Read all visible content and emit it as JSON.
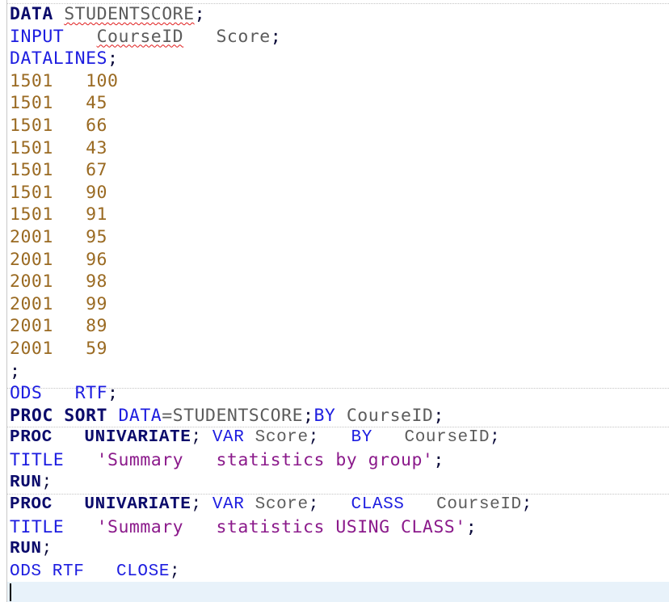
{
  "editor": {
    "lines": [
      {
        "tokens": [
          {
            "t": "DATA",
            "k": "kw-bold"
          },
          {
            "t": " ",
            "k": "space"
          },
          {
            "t": "STUDENTSCORE",
            "k": "ident",
            "sq": true
          },
          {
            "t": ";",
            "k": "punct"
          }
        ]
      },
      {
        "tokens": [
          {
            "t": "INPUT",
            "k": "kw"
          },
          {
            "t": "   ",
            "k": "space"
          },
          {
            "t": "CourseID",
            "k": "ident",
            "sq": true
          },
          {
            "t": "   ",
            "k": "space"
          },
          {
            "t": "Score",
            "k": "ident"
          },
          {
            "t": ";",
            "k": "punct"
          }
        ]
      },
      {
        "tokens": [
          {
            "t": "DATALINES",
            "k": "kw"
          },
          {
            "t": ";",
            "k": "punct"
          }
        ]
      },
      {
        "tokens": [
          {
            "t": "1501   100",
            "k": "data"
          }
        ]
      },
      {
        "tokens": [
          {
            "t": "1501   45",
            "k": "data"
          }
        ]
      },
      {
        "tokens": [
          {
            "t": "1501   66",
            "k": "data"
          }
        ]
      },
      {
        "tokens": [
          {
            "t": "1501   43",
            "k": "data"
          }
        ]
      },
      {
        "tokens": [
          {
            "t": "1501   67",
            "k": "data"
          }
        ]
      },
      {
        "tokens": [
          {
            "t": "1501   90",
            "k": "data"
          }
        ]
      },
      {
        "tokens": [
          {
            "t": "1501   91",
            "k": "data"
          }
        ]
      },
      {
        "tokens": [
          {
            "t": "2001   95",
            "k": "data"
          }
        ]
      },
      {
        "tokens": [
          {
            "t": "2001   96",
            "k": "data"
          }
        ]
      },
      {
        "tokens": [
          {
            "t": "2001   98",
            "k": "data"
          }
        ]
      },
      {
        "tokens": [
          {
            "t": "2001   99",
            "k": "data"
          }
        ]
      },
      {
        "tokens": [
          {
            "t": "2001   89",
            "k": "data"
          }
        ]
      },
      {
        "tokens": [
          {
            "t": "2001   59",
            "k": "data"
          }
        ]
      },
      {
        "tokens": [
          {
            "t": ";",
            "k": "punct"
          }
        ]
      },
      {
        "tokens": [
          {
            "t": "ODS",
            "k": "kw"
          },
          {
            "t": "   ",
            "k": "space"
          },
          {
            "t": "RTF",
            "k": "kw"
          },
          {
            "t": ";",
            "k": "punct"
          }
        ]
      },
      {
        "tokens": [
          {
            "t": "PROC SORT",
            "k": "kw-bold"
          },
          {
            "t": " ",
            "k": "space"
          },
          {
            "t": "DATA",
            "k": "kw"
          },
          {
            "t": "=STUDENTSCORE",
            "k": "ident"
          },
          {
            "t": ";",
            "k": "punct"
          },
          {
            "t": "BY",
            "k": "kw"
          },
          {
            "t": " ",
            "k": "space"
          },
          {
            "t": "CourseID",
            "k": "ident"
          },
          {
            "t": ";",
            "k": "punct"
          }
        ]
      },
      {
        "narrow": true,
        "tokens": [
          {
            "t": "PROC",
            "k": "kw-bold"
          },
          {
            "t": "   ",
            "k": "space"
          },
          {
            "t": "UNIVARIATE",
            "k": "kw-bold"
          },
          {
            "t": ";",
            "k": "punct"
          },
          {
            "t": " ",
            "k": "space"
          },
          {
            "t": "VAR",
            "k": "kw"
          },
          {
            "t": " ",
            "k": "space"
          },
          {
            "t": "Score",
            "k": "ident"
          },
          {
            "t": ";",
            "k": "punct"
          },
          {
            "t": "   ",
            "k": "space"
          },
          {
            "t": "BY",
            "k": "kw"
          },
          {
            "t": "   ",
            "k": "space"
          },
          {
            "t": "CourseID",
            "k": "ident"
          },
          {
            "t": ";",
            "k": "punct"
          }
        ]
      },
      {
        "tokens": [
          {
            "t": "TITLE",
            "k": "kw"
          },
          {
            "t": "   ",
            "k": "space"
          },
          {
            "t": "'Summary   statistics by group'",
            "k": "str"
          },
          {
            "t": ";",
            "k": "punct"
          }
        ]
      },
      {
        "narrow": true,
        "tokens": [
          {
            "t": "RUN",
            "k": "kw-bold"
          },
          {
            "t": ";",
            "k": "punct"
          }
        ]
      },
      {
        "narrow": true,
        "tokens": [
          {
            "t": "PROC",
            "k": "kw-bold"
          },
          {
            "t": "   ",
            "k": "space"
          },
          {
            "t": "UNIVARIATE",
            "k": "kw-bold"
          },
          {
            "t": ";",
            "k": "punct"
          },
          {
            "t": " ",
            "k": "space"
          },
          {
            "t": "VAR",
            "k": "kw"
          },
          {
            "t": " ",
            "k": "space"
          },
          {
            "t": "Score",
            "k": "ident"
          },
          {
            "t": ";",
            "k": "punct"
          },
          {
            "t": "   ",
            "k": "space"
          },
          {
            "t": "CLASS",
            "k": "kw"
          },
          {
            "t": "   ",
            "k": "space"
          },
          {
            "t": "CourseID",
            "k": "ident"
          },
          {
            "t": ";",
            "k": "punct"
          }
        ]
      },
      {
        "tokens": [
          {
            "t": "TITLE",
            "k": "kw"
          },
          {
            "t": "   ",
            "k": "space"
          },
          {
            "t": "'Summary   statistics USING CLASS'",
            "k": "str"
          },
          {
            "t": ";",
            "k": "punct"
          }
        ]
      },
      {
        "narrow": true,
        "tokens": [
          {
            "t": "RUN",
            "k": "kw-bold"
          },
          {
            "t": ";",
            "k": "punct"
          }
        ]
      },
      {
        "narrow": true,
        "tokens": [
          {
            "t": "ODS RTF",
            "k": "kw"
          },
          {
            "t": "   ",
            "k": "space"
          },
          {
            "t": "CLOSE",
            "k": "kw"
          },
          {
            "t": ";",
            "k": "punct"
          }
        ]
      },
      {
        "tokens": []
      }
    ]
  }
}
